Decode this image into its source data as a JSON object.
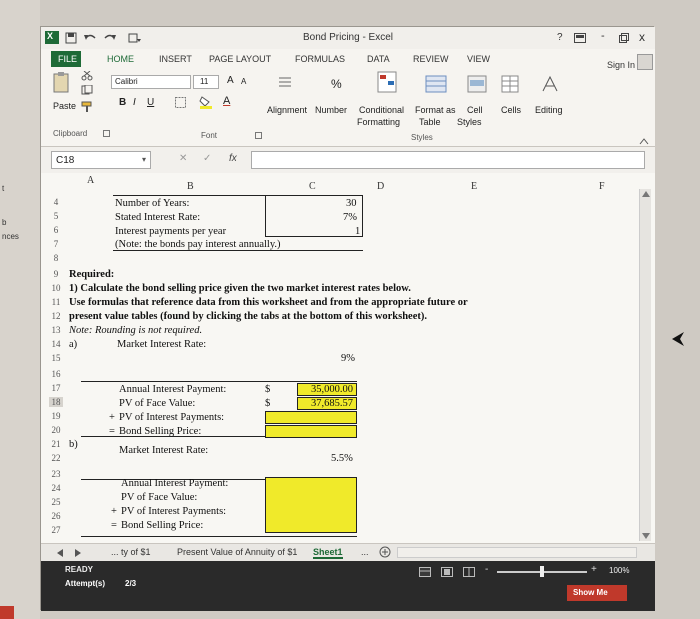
{
  "left_fragments": [
    "t",
    "b",
    "nces"
  ],
  "titlebar": {
    "title": "Bond Pricing - Excel",
    "help": "?",
    "minimize": "-",
    "close": "x"
  },
  "tabs": [
    "FILE",
    "HOME",
    "INSERT",
    "PAGE LAYOUT",
    "FORMULAS",
    "DATA",
    "REVIEW",
    "VIEW"
  ],
  "signin": "Sign In",
  "ribbon": {
    "paste": "Paste",
    "font_name": "Calibri",
    "font_size": "11",
    "bold": "B",
    "italic": "I",
    "underline": "U",
    "alignment": "Alignment",
    "number": "Number",
    "percent": "%",
    "conditional_1": "Conditional",
    "conditional_2": "Formatting",
    "format_table_1": "Format as",
    "format_table_2": "Table",
    "cell_styles_1": "Cell",
    "cell_styles_2": "Styles",
    "cells": "Cells",
    "editing": "Editing",
    "clipboard": "Clipboard",
    "font": "Font",
    "styles": "Styles"
  },
  "formula_bar": {
    "name_box": "C18",
    "fx": "fx",
    "value": ""
  },
  "columns": [
    "A",
    "B",
    "C",
    "D",
    "E",
    "F"
  ],
  "sheet": {
    "r4": {
      "num": "4",
      "b": "Number of Years:",
      "c": "30"
    },
    "r5": {
      "num": "5",
      "b": "Stated Interest Rate:",
      "c": "7%"
    },
    "r6": {
      "num": "6",
      "b": "Interest payments per year",
      "c": "1"
    },
    "r7": {
      "num": "7",
      "b": "(Note: the bonds pay interest annually.)"
    },
    "r8": {
      "num": "8"
    },
    "r9": {
      "num": "9",
      "a": "Required:"
    },
    "r10": {
      "num": "10",
      "a": "1) Calculate the bond selling price given the two market interest rates below."
    },
    "r11": {
      "num": "11",
      "a": "Use formulas that reference data from this worksheet and from the appropriate future or"
    },
    "r12": {
      "num": "12",
      "a": "present value tables (found by clicking the tabs at the bottom of this worksheet)."
    },
    "r13": {
      "num": "13",
      "a": "Note: Rounding is not required."
    },
    "r14": {
      "num": "14",
      "a": "a)",
      "b": "Market Interest Rate:"
    },
    "r15": {
      "num": "15",
      "c": "9%"
    },
    "r16": {
      "num": "16"
    },
    "r17": {
      "num": "17",
      "b": "Annual Interest Payment:",
      "dollar": "$",
      "c": "35,000.00"
    },
    "r18": {
      "num": "18",
      "b": "PV of Face Value:",
      "dollar": "$",
      "c": "37,685.57"
    },
    "r19": {
      "num": "19",
      "op": "+",
      "b": "PV of Interest Payments:"
    },
    "r20": {
      "num": "20",
      "op": "=",
      "b": "Bond Selling Price:"
    },
    "r21": {
      "num": "21",
      "a": "b)",
      "b": "Market Interest Rate:"
    },
    "r22": {
      "num": "22",
      "c": "5.5%"
    },
    "r23": {
      "num": "23"
    },
    "r24": {
      "num": "24",
      "b": "Annual Interest Payment:"
    },
    "r25": {
      "num": "25",
      "b": "PV of Face Value:"
    },
    "r26": {
      "num": "26",
      "op": "+",
      "b": "PV of Interest Payments:"
    },
    "r27": {
      "num": "27",
      "op": "=",
      "b": "Bond Selling Price:"
    }
  },
  "sheet_tabs": [
    "... ty of $1",
    "Present Value of Annuity of $1",
    "Sheet1",
    "..."
  ],
  "status": {
    "ready": "READY",
    "attempts_label": "Attempt(s)",
    "attempts_value": "2/3",
    "zoom": "100%",
    "show_me": "Show Me"
  },
  "colors": {
    "accent": "#1e6a37",
    "yellow": "#f0ea2a",
    "show_me": "#c0392b"
  }
}
